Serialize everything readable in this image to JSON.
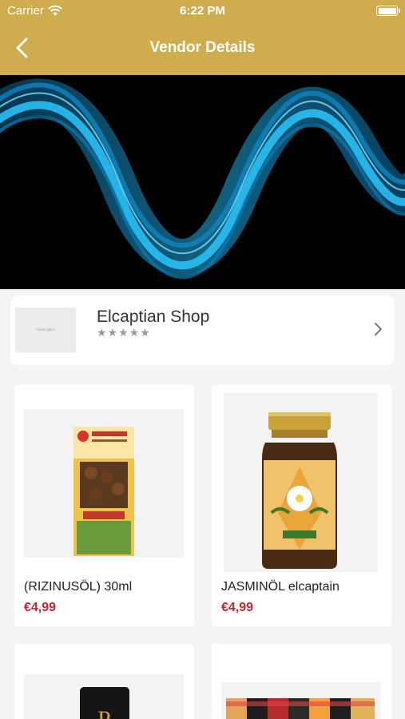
{
  "status_bar": {
    "carrier": "Carrier",
    "time": "6:22 PM"
  },
  "nav": {
    "title": "Vendor Details"
  },
  "vendor": {
    "name": "Elcaptian Shop",
    "logo_text": "Good space",
    "rating_stars": "★★★★★",
    "rating": 0
  },
  "products": [
    {
      "name": "(RIZINUSÖL) 30ml",
      "price": "€4,99"
    },
    {
      "name": "JASMINÖL elcaptain",
      "price": "€4,99"
    }
  ],
  "colors": {
    "header": "#cfac4c",
    "price": "#c0272d",
    "background": "#f4f4f4"
  }
}
